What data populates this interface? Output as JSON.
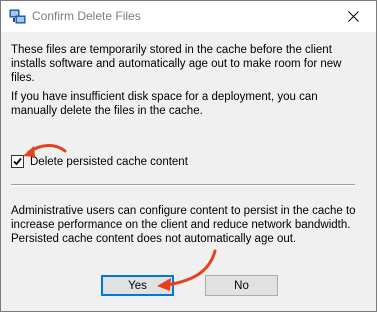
{
  "window": {
    "title": "Confirm Delete Files",
    "app_icon": "computer-network-icon",
    "close_icon": "close-icon"
  },
  "body": {
    "paragraph1": "These files are temporarily stored in the cache before the client installs software and automatically age out to make room for new files.",
    "paragraph2": "If you have insufficient disk space for a deployment, you can manually delete the files in the cache.",
    "checkbox_label": "Delete persisted cache content",
    "checkbox_checked": true,
    "paragraph3": "Administrative users can configure content to persist in the cache to increase performance on the client and reduce network bandwidth. Persisted cache content does not automatically age out."
  },
  "buttons": {
    "yes_label": "Yes",
    "no_label": "No"
  },
  "colors": {
    "annotation_arrow": "#e8401c",
    "focus_border": "#0078d7",
    "client_background": "#f0f0f0"
  }
}
